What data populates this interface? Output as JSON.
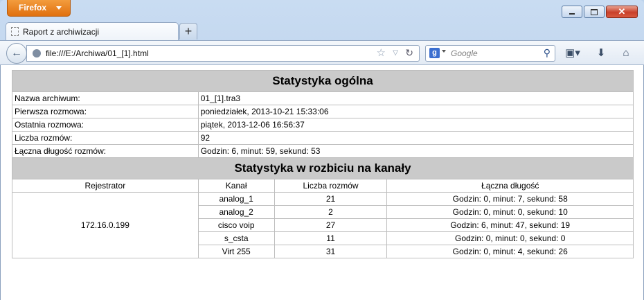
{
  "browser": {
    "app_button": "Firefox",
    "tab_title": "Raport z archiwizacji",
    "new_tab": "+",
    "url": "file:///E:/Archiwa/01_[1].html",
    "search_placeholder": "Google",
    "search_engine_letter": "g"
  },
  "general": {
    "heading": "Statystyka ogólna",
    "rows": [
      {
        "label": "Nazwa archiwum:",
        "value": "01_[1].tra3"
      },
      {
        "label": "Pierwsza rozmowa:",
        "value": "poniedziałek, 2013-10-21 15:33:06"
      },
      {
        "label": "Ostatnia rozmowa:",
        "value": "piątek, 2013-12-06 16:56:37"
      },
      {
        "label": "Liczba rozmów:",
        "value": "92"
      },
      {
        "label": "Łączna długość rozmów:",
        "value": "Godzin: 6, minut: 59, sekund: 53"
      }
    ]
  },
  "channels": {
    "heading": "Statystyka w rozbiciu na kanały",
    "columns": [
      "Rejestrator",
      "Kanał",
      "Liczba rozmów",
      "Łączna długość"
    ],
    "recorder": "172.16.0.199",
    "rows": [
      {
        "channel": "analog_1",
        "count": "21",
        "duration": "Godzin: 0, minut: 7, sekund: 58"
      },
      {
        "channel": "analog_2",
        "count": "2",
        "duration": "Godzin: 0, minut: 0, sekund: 10"
      },
      {
        "channel": "cisco voip",
        "count": "27",
        "duration": "Godzin: 6, minut: 47, sekund: 19"
      },
      {
        "channel": "s_csta",
        "count": "11",
        "duration": "Godzin: 0, minut: 0, sekund: 0"
      },
      {
        "channel": "Virt 255",
        "count": "31",
        "duration": "Godzin: 0, minut: 4, sekund: 26"
      }
    ]
  }
}
